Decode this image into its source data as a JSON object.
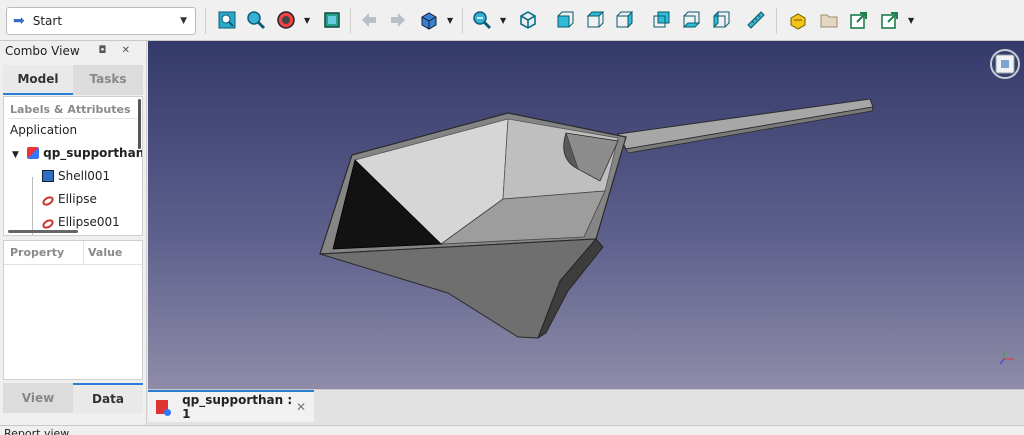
{
  "toolbar": {
    "workbench": "Start",
    "icons": [
      "fit-all-icon",
      "fit-selection-icon",
      "draw-style-icon",
      "bounding-box-icon",
      "nav-back-icon",
      "nav-forward-icon",
      "std-views-icon",
      "zoom-icon",
      "isometric-view-icon",
      "front-view-icon",
      "top-view-icon",
      "right-view-icon",
      "rear-view-icon",
      "bottom-view-icon",
      "left-view-icon",
      "measure-icon",
      "part-icon",
      "group-icon",
      "link-icon",
      "link-actions-icon"
    ]
  },
  "combo": {
    "title": "Combo View",
    "title_buttons": "◘ ✕",
    "tabs": [
      "Model",
      "Tasks"
    ],
    "tree": {
      "header": "Labels & Attributes",
      "application": "Application",
      "document": "qp_supporthan",
      "children": [
        "Shell001",
        "Ellipse",
        "Ellipse001"
      ]
    },
    "properties": {
      "col_property": "Property",
      "col_value": "Value"
    },
    "bottom_tabs": [
      "View",
      "Data"
    ]
  },
  "document_tab": {
    "label": "qp_supporthan : 1",
    "close": "✕"
  },
  "report": {
    "title": "Report view"
  },
  "colors": {
    "accent": "#2a7fd4",
    "shape_light": "#bdbdbd",
    "shape_dark": "#6f6f6f"
  }
}
